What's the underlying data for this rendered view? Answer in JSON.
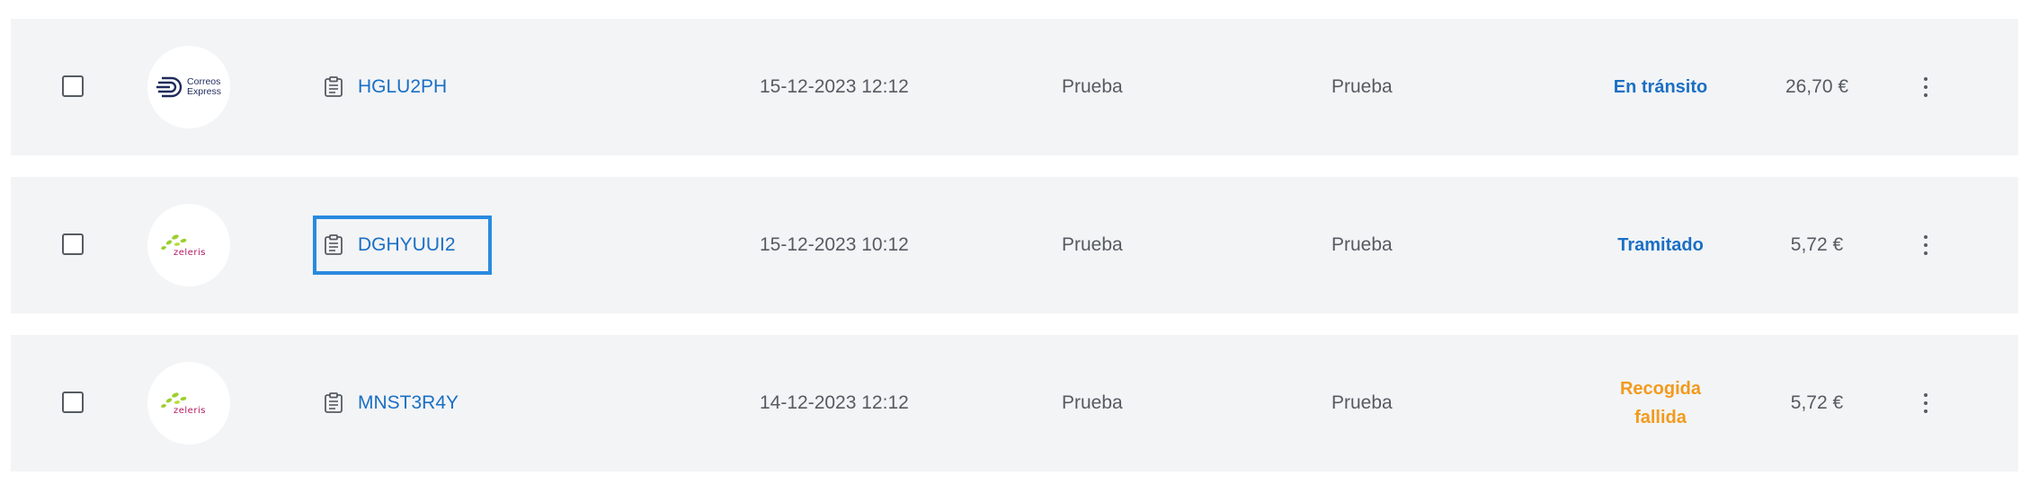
{
  "colors": {
    "row_background": "#f3f4f6",
    "link": "#1a6fc4",
    "status_blue": "#1a6fc4",
    "status_orange": "#f39a1c",
    "focus_outline": "#2a8ae0"
  },
  "shipments": [
    {
      "carrier": "Correos Express",
      "carrier_logo_lines": [
        "Correos",
        "Express"
      ],
      "tracking_icon": "clipboard-icon",
      "tracking": "HGLU2PH",
      "date": "15-12-2023 12:12",
      "origin": "Prueba",
      "destination": "Prueba",
      "status": "En tránsito",
      "status_color": "#1a6fc4",
      "price": "26,70 €",
      "focused": false
    },
    {
      "carrier": "Zeleris",
      "carrier_logo_text": "zeleris",
      "tracking_icon": "clipboard-icon",
      "tracking": "DGHYUUI2",
      "date": "15-12-2023 10:12",
      "origin": "Prueba",
      "destination": "Prueba",
      "status": "Tramitado",
      "status_color": "#1a6fc4",
      "price": "5,72 €",
      "focused": true
    },
    {
      "carrier": "Zeleris",
      "carrier_logo_text": "zeleris",
      "tracking_icon": "clipboard-icon",
      "tracking": "MNST3R4Y",
      "date": "14-12-2023 12:12",
      "origin": "Prueba",
      "destination": "Prueba",
      "status": "Recogida fallida",
      "status_color": "#f39a1c",
      "price": "5,72 €",
      "focused": false
    }
  ]
}
